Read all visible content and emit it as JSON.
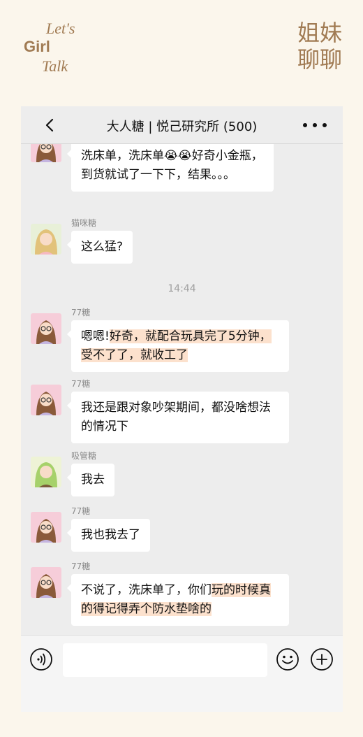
{
  "branding": {
    "lets": "Let's",
    "girl": "Girl",
    "talk": "Talk",
    "corner_line1": "姐妹",
    "corner_line2": "聊聊"
  },
  "nav": {
    "title": "大人糖 | 悦己研究所 (500)",
    "back_icon": "chevron-left-icon",
    "more_icon": "more-dots-icon"
  },
  "messages": [
    {
      "sender": "",
      "avatar": "avatar-brown-glasses",
      "text": "洗床单，洗床单😭😭好奇小金瓶，到货就试了一下下，结果。。。"
    },
    {
      "sender": "猫咪糖",
      "avatar": "avatar-blonde",
      "text": "这么猛?"
    },
    {
      "time": "14:44"
    },
    {
      "sender": "77糖",
      "avatar": "avatar-brown-glasses",
      "text_plain": "嗯嗯!",
      "text_highlight": "好奇，就配合玩具完了5分钟，受不了了，就收工了"
    },
    {
      "sender": "77糖",
      "avatar": "avatar-brown-glasses",
      "text": "我还是跟对象吵架期间，都没啥想法的情况下"
    },
    {
      "sender": "吸管糖",
      "avatar": "avatar-green",
      "text": "我去"
    },
    {
      "sender": "77糖",
      "avatar": "avatar-brown-glasses",
      "text": "我也我去了"
    },
    {
      "sender": "77糖",
      "avatar": "avatar-brown-glasses",
      "text_plain": "不说了，洗床单了，你们",
      "text_highlight": "玩的时候真的得记得弄个防水垫啥的"
    }
  ],
  "input": {
    "placeholder": "",
    "value": ""
  },
  "colors": {
    "brand": "#a07a52",
    "page_bg": "#fbf6ec",
    "chat_bg": "#ededed",
    "highlight": "#fce1cd"
  }
}
